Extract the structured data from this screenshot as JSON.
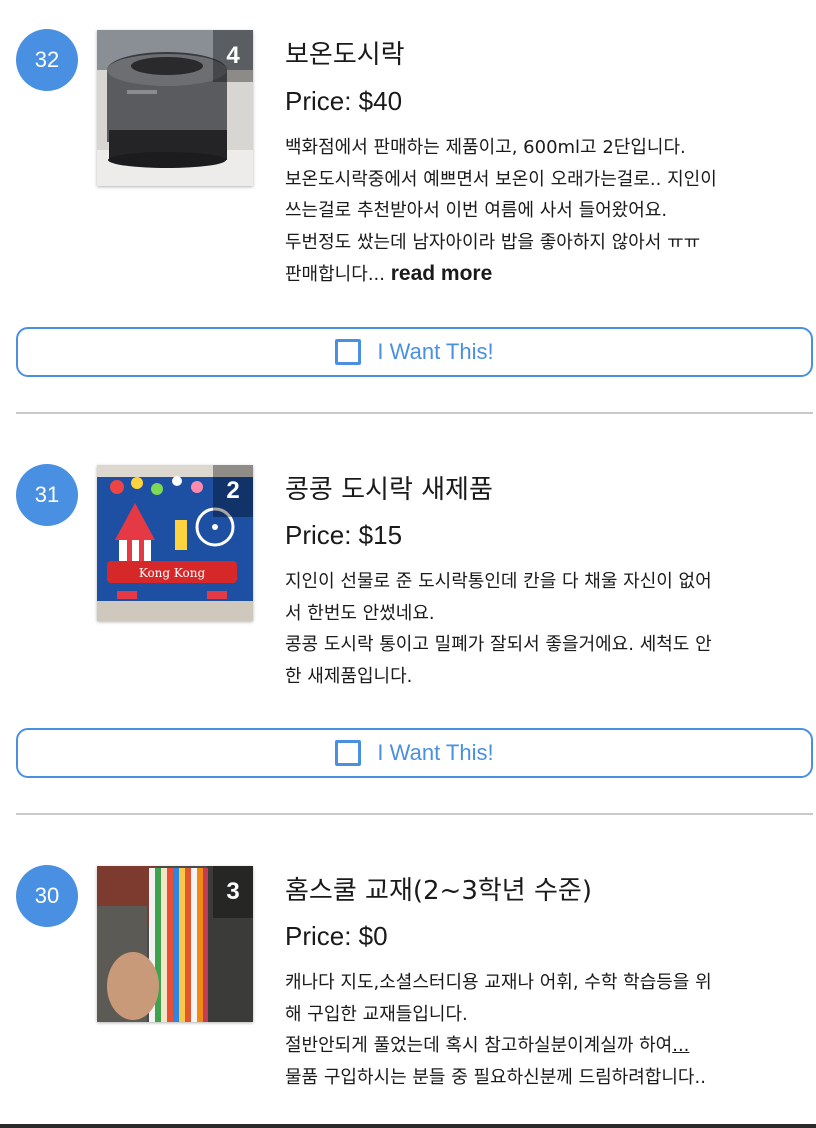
{
  "listings": [
    {
      "number": "32",
      "photo_count": "4",
      "title": "보온도시락",
      "price": "Price: $40",
      "description_lines": [
        "백화점에서 판매하는 제품이고, 600ml고 2단입니다.",
        "보온도시락중에서 예쁘면서 보온이 오래가는걸로.. 지인이",
        "쓰는걸로 추천받아서 이번 여름에 사서 들어왔어요.",
        "두번정도 쌌는데 남자아이라 밥을 좋아하지 않아서 ㅠㅠ",
        "판매합니다"
      ],
      "ellipsis": "...",
      "read_more": "read more",
      "button_label": "I Want This!"
    },
    {
      "number": "31",
      "photo_count": "2",
      "title": "콩콩 도시락 새제품",
      "price": "Price: $15",
      "description_lines": [
        "지인이 선물로 준 도시락통인데 칸을 다 채울 자신이 없어",
        "서 한번도 안썼네요.",
        "콩콩 도시락 통이고 밀폐가 잘되서 좋을거에요. 세척도 안",
        "한 새제품입니다."
      ],
      "image_text": "Kong Kong",
      "button_label": "I Want This!"
    },
    {
      "number": "30",
      "photo_count": "3",
      "title": "홈스쿨 교재(2~3학년 수준)",
      "price": "Price: $0",
      "description_lines": [
        "캐나다 지도,소셜스터디용 교재나 어휘, 수학 학습등을 위",
        "해 구입한 교재들입니다.",
        "절반안되게 풀었는데 혹시 참고하실분이계실까 하여",
        "물품 구입하시는 분들 중 필요하신분께 드림하려합니다.."
      ],
      "ellipsis": "..."
    }
  ],
  "colors": {
    "accent": "#4a90e2",
    "divider": "#c9c9c9",
    "text": "#1a1a1a"
  },
  "icons": {
    "checkbox": "checkbox-outline-icon"
  }
}
